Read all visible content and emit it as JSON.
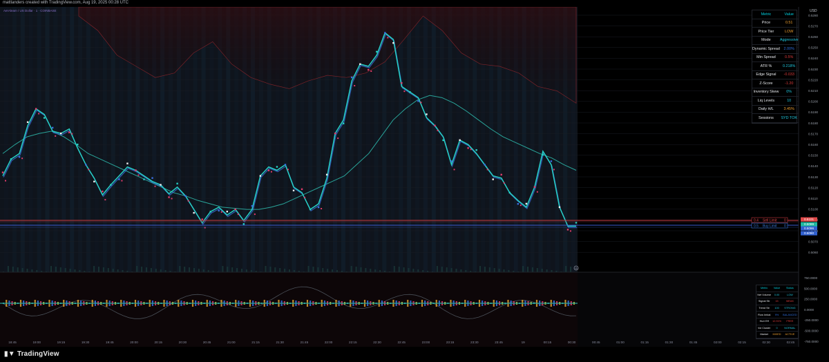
{
  "header": {
    "text": "mattlanders created with TradingView.com, Aug 19, 2025 00:28 UTC",
    "symbol": "AerAleam / US Dollar · 1 · COINBASE"
  },
  "price_axis": {
    "unit": "USD",
    "labels": [
      "0.5280",
      "0.5270",
      "0.5260",
      "0.5250",
      "0.5240",
      "0.5230",
      "0.5220",
      "0.5210",
      "0.5200",
      "0.5190",
      "0.5180",
      "0.5170",
      "0.5160",
      "0.5150",
      "0.5140",
      "0.5130",
      "0.5120",
      "0.5110",
      "0.5100",
      "0.5090",
      "0.5080",
      "0.5070",
      "0.5060"
    ],
    "tags": [
      {
        "text": "0.5101",
        "color": "#e04848"
      },
      {
        "text": "0.5099",
        "color": "#1fb8a0"
      },
      {
        "text": "0.5096",
        "color": "#3060d0"
      },
      {
        "text": "0.5090",
        "color": "#3060d0"
      }
    ]
  },
  "osc_axis": {
    "labels": [
      "750.0000",
      "500.0000",
      "250.0000",
      "0.0000",
      "-250.0000",
      "-500.0000",
      "-750.0000"
    ]
  },
  "time_axis": {
    "labels": [
      "18:45",
      "19:00",
      "19:15",
      "19:30",
      "19:45",
      "20:00",
      "20:15",
      "20:30",
      "20:45",
      "21:00",
      "21:15",
      "21:30",
      "21:45",
      "22:00",
      "22:15",
      "22:30",
      "22:45",
      "23:00",
      "23:15",
      "23:30",
      "23:45",
      "19",
      "00:15",
      "00:30",
      "00:45",
      "01:00",
      "01:15",
      "01:30",
      "01:45",
      "02:00",
      "02:15",
      "02:30",
      "02:45"
    ]
  },
  "limit_labels": [
    {
      "tag": "0.4",
      "text": "Sell Limit",
      "value": "0",
      "color": "#e04848"
    },
    {
      "tag": "0.5",
      "text": "Buy Limit",
      "value": "0",
      "color": "#3a7be0"
    }
  ],
  "metrics_table": {
    "headers": [
      "Metric",
      "Value"
    ],
    "rows": [
      {
        "metric": "Price",
        "value": "0.51",
        "color": "#f0a030"
      },
      {
        "metric": "Price Tier",
        "value": "LOW",
        "color": "#f0a030"
      },
      {
        "metric": "Mode",
        "value": "Aggressive",
        "color": "#20c8e0"
      },
      {
        "metric": "Dynamic Spread",
        "value": "2.00%",
        "color": "#3070e0"
      },
      {
        "metric": "Min Spread",
        "value": "0.5%",
        "color": "#e03c3c"
      },
      {
        "metric": "ATR %",
        "value": "0.218%",
        "color": "#20c8e0"
      },
      {
        "metric": "Edge Signal",
        "value": "-0.033",
        "color": "#e03c3c"
      },
      {
        "metric": "Z-Score",
        "value": "-1.20",
        "color": "#e03c3c"
      },
      {
        "metric": "Inventory Skew",
        "value": "0%",
        "color": "#20c8e0"
      },
      {
        "metric": "Liq Levels",
        "value": "10",
        "color": "#20c8e0"
      },
      {
        "metric": "Daily H/L",
        "value": "3.45%",
        "color": "#f0a030"
      },
      {
        "metric": "Sessions",
        "value": "SYD TOK",
        "color": "#20c8e0"
      }
    ]
  },
  "flow_table": {
    "headers": [
      "Metric",
      "Value",
      "Status"
    ],
    "rows": [
      {
        "metric": "Net Volume",
        "value": "0.00",
        "status": "LOW",
        "color": "#20c8e0"
      },
      {
        "metric": "Signal Str",
        "value": "15",
        "status": "WEAK",
        "color": "#e03c3c"
      },
      {
        "metric": "Trend Str",
        "value": "100",
        "status": "STRONG",
        "color": "#20c8e0"
      },
      {
        "metric": "Flow Imbal",
        "value": "9%",
        "status": "BALANCED",
        "color": "#3070e0"
      },
      {
        "metric": "Hurr Eff",
        "value": "12.91%",
        "status": "FREE",
        "color": "#e03c3c"
      },
      {
        "metric": "Vol Cluster",
        "value": "0",
        "status": "NORMAL",
        "color": "#20c8e0"
      },
      {
        "metric": "Market",
        "value": "MIXED",
        "status": "ACTIVE",
        "color": "#f0a030"
      }
    ]
  },
  "footer": {
    "brand": "TradingView",
    "settings_label": "⚙"
  },
  "chart_data": {
    "type": "line",
    "x_start": "18:45",
    "x_step_minutes": 15,
    "ylim": [
      0.506,
      0.5285
    ],
    "price": [
      0.514,
      0.5155,
      0.516,
      0.5185,
      0.52,
      0.5195,
      0.518,
      0.5178,
      0.5182,
      0.5165,
      0.515,
      0.5138,
      0.5123,
      0.5132,
      0.514,
      0.5148,
      0.5145,
      0.514,
      0.5135,
      0.5132,
      0.5124,
      0.513,
      0.5122,
      0.511,
      0.5098,
      0.5108,
      0.5112,
      0.5105,
      0.511,
      0.51,
      0.511,
      0.514,
      0.5148,
      0.5145,
      0.515,
      0.513,
      0.5125,
      0.511,
      0.5115,
      0.5138,
      0.5178,
      0.519,
      0.5225,
      0.524,
      0.5238,
      0.5248,
      0.5268,
      0.5262,
      0.522,
      0.5215,
      0.521,
      0.5192,
      0.5185,
      0.5175,
      0.515,
      0.5172,
      0.5168,
      0.516,
      0.515,
      0.514,
      0.5138,
      0.5125,
      0.5118,
      0.5112,
      0.513,
      0.5162,
      0.515,
      0.5112,
      0.5095,
      0.5095
    ],
    "ma": [
      0.516,
      0.5168,
      0.5175,
      0.5178,
      0.518,
      0.5175,
      0.5168,
      0.516,
      0.5155,
      0.515,
      0.5145,
      0.514,
      0.5135,
      0.513,
      0.5125,
      0.5122,
      0.5118,
      0.5115,
      0.5112,
      0.5111,
      0.511,
      0.511,
      0.5112,
      0.5115,
      0.512,
      0.5125,
      0.513,
      0.5135,
      0.514,
      0.515,
      0.516,
      0.5175,
      0.519,
      0.52,
      0.5208,
      0.5212,
      0.521,
      0.5205,
      0.5198,
      0.519,
      0.5182,
      0.5175,
      0.517,
      0.5165,
      0.516,
      0.5156,
      0.515,
      0.5145
    ],
    "upper_band": [
      0.5283,
      0.527,
      0.5248,
      0.5238,
      0.5228,
      0.5232,
      0.525,
      0.526,
      0.524,
      0.5228,
      0.5222,
      0.5218,
      0.5225,
      0.523,
      0.5228,
      0.5232,
      0.5242,
      0.5262,
      0.5283,
      0.527,
      0.525,
      0.524,
      0.5238,
      0.5232,
      0.522,
      0.5216,
      0.5205
    ],
    "osc_range": [
      -750,
      750
    ]
  }
}
